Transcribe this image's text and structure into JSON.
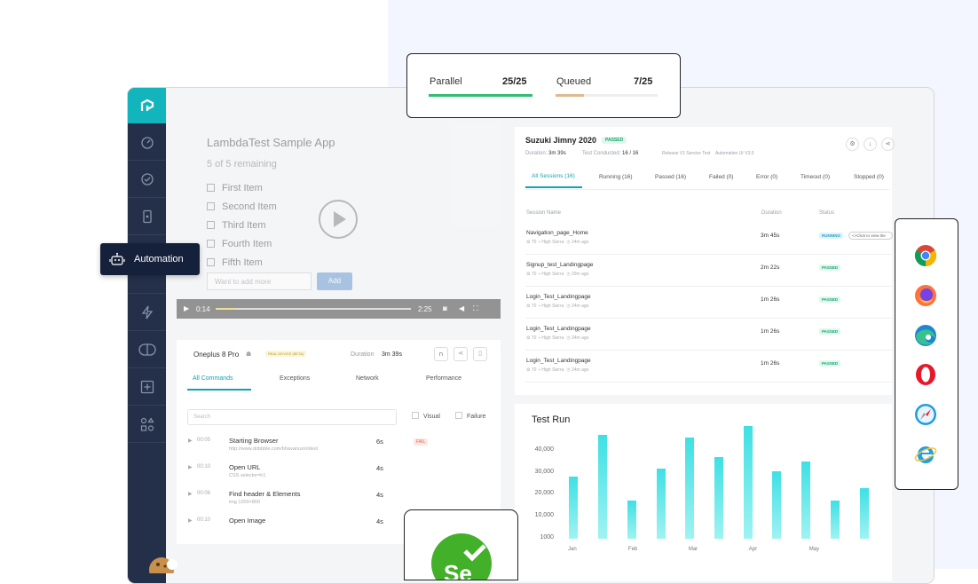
{
  "tooltip": {
    "label": "Automation"
  },
  "parallel": {
    "label": "Parallel",
    "value": "25/25",
    "color": "#2fbe75",
    "fill": 1.0
  },
  "queued": {
    "label": "Queued",
    "value": "7/25",
    "color": "#e0b98f",
    "fill": 0.28
  },
  "sample_app": {
    "title": "LambdaTest Sample App",
    "remaining": "5 of 5 remaining",
    "items": [
      "First Item",
      "Second Item",
      "Third Item",
      "Fourth Item",
      "Fifth Item"
    ],
    "placeholder": "Want to add more",
    "add_button": "Add"
  },
  "video": {
    "current": "0:14",
    "duration": "2:25",
    "progress": 0.1
  },
  "device": {
    "name": "Oneplus 8 Pro",
    "tag": "REAL DEVICE (BETA)",
    "duration_label": "Duration",
    "duration_value": "3m 39s",
    "tabs": [
      "All Commands",
      "Exceptions",
      "Network",
      "Performance"
    ],
    "search_placeholder": "Search",
    "filter_visual": "Visual",
    "filter_failure": "Failure",
    "commands": [
      {
        "time": "00:05",
        "name": "Starting Browser",
        "detail": "http://www.dribbble.com/bhavanux/oldest",
        "duration": "6s",
        "badge": "FAIL"
      },
      {
        "time": "00:10",
        "name": "Open URL",
        "detail": "CSS selector=h1",
        "duration": "4s",
        "badge": ""
      },
      {
        "time": "00:06",
        "name": "Find header & Elements",
        "detail": "img 1200×800",
        "duration": "4s",
        "badge": ""
      },
      {
        "time": "00:10",
        "name": "Open Image",
        "detail": "",
        "duration": "4s",
        "badge": ""
      }
    ]
  },
  "build": {
    "name": "Suzuki Jimny 2020",
    "status": "PASSED",
    "duration_label": "Duration:",
    "duration_value": "3m 39s",
    "tests_label": "Test Conducted:",
    "tests_value": "16 / 16",
    "meta1": "Release V1 Service Test",
    "meta2": "Automation UI V3.0",
    "tabs": [
      "All Sessions (16)",
      "Running (16)",
      "Passed (16)",
      "Failed (0)",
      "Error (0)",
      "Timeout (0)",
      "Stopped (0)"
    ],
    "col_session": "Session Name",
    "col_duration": "Duration",
    "col_status": "Status",
    "sessions": [
      {
        "name": "Navigation_page_Home",
        "os": "70",
        "env": "High Sierra",
        "ago": "24m ago",
        "duration": "3m 45s",
        "status": "RUNNING",
        "extra": "<>Click to view the"
      },
      {
        "name": "Signup_test_Landingpage",
        "os": "70",
        "env": "High Sierra",
        "ago": "29m ago",
        "duration": "2m 22s",
        "status": "PASSED",
        "extra": ""
      },
      {
        "name": "Login_Test_Landingpage",
        "os": "70",
        "env": "High Sierra",
        "ago": "24m ago",
        "duration": "1m 26s",
        "status": "PASSED",
        "extra": ""
      },
      {
        "name": "Login_Test_Landingpage",
        "os": "70",
        "env": "High Sierra",
        "ago": "24m ago",
        "duration": "1m 26s",
        "status": "PASSED",
        "extra": ""
      },
      {
        "name": "Login_Test_Landingpage",
        "os": "70",
        "env": "High Sierra",
        "ago": "24m ago",
        "duration": "1m 26s",
        "status": "PASSED",
        "extra": ""
      }
    ]
  },
  "browsers": [
    "chrome-icon",
    "firefox-icon",
    "edge-icon",
    "opera-icon",
    "safari-icon",
    "ie-icon"
  ],
  "chart_data": {
    "type": "bar",
    "title": "Test Run",
    "categories": [
      "Jan",
      "Feb",
      "Mar",
      "Apr",
      "May"
    ],
    "yticks": [
      "40,000",
      "30,000",
      "20,000",
      "10,000",
      "1000"
    ],
    "ylim": [
      0,
      45000
    ],
    "values": [
      26000,
      43000,
      16000,
      29000,
      42000,
      34000,
      47000,
      28000,
      32000,
      16000,
      21000
    ],
    "color": "#3ee0e4",
    "grid": false
  }
}
